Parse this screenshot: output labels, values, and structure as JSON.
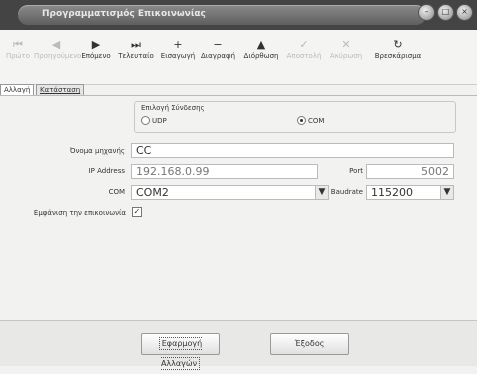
{
  "window": {
    "title": "Προγραμματισμός Επικοινωνίας",
    "buttons": [
      "–",
      "□",
      "×"
    ]
  },
  "toolbar": [
    {
      "label": "Πρώτο",
      "icon": "first-icon",
      "glyph": "⏮",
      "enabled": false
    },
    {
      "label": "Προηγούμενο",
      "icon": "previous-icon",
      "glyph": "◀",
      "enabled": false
    },
    {
      "label": "Επόμενο",
      "icon": "next-icon",
      "glyph": "▶",
      "enabled": true
    },
    {
      "label": "Τελευταίο",
      "icon": "last-icon",
      "glyph": "⏭",
      "enabled": true
    },
    {
      "label": "Εισαγωγή",
      "icon": "insert-icon",
      "glyph": "+",
      "enabled": true
    },
    {
      "label": "Διαγραφή",
      "icon": "delete-icon",
      "glyph": "−",
      "enabled": true
    },
    {
      "label": "Διόρθωση",
      "icon": "edit-icon",
      "glyph": "▲",
      "enabled": true
    },
    {
      "label": "Αποστολή",
      "icon": "send-icon",
      "glyph": "✓",
      "enabled": false
    },
    {
      "label": "Ακύρωση",
      "icon": "cancel-icon",
      "glyph": "✕",
      "enabled": false
    },
    {
      "label": "Βρεσκάρισμα",
      "icon": "refresh-icon",
      "glyph": "↻",
      "enabled": true
    }
  ],
  "tabs": [
    {
      "label": "Αλλαγή",
      "active": true
    },
    {
      "label": "Κατάσταση",
      "active": false
    }
  ],
  "connection": {
    "group_label": "Επιλογή Σύνδεσης",
    "options": [
      {
        "label": "UDP",
        "selected": false
      },
      {
        "label": "COM",
        "selected": true
      }
    ]
  },
  "form": {
    "name_label": "Όνομα μηχανής",
    "name_value": "CC",
    "ip_label": "IP Address",
    "ip_value": "192.168.0.99",
    "port_label": "Port",
    "port_value": "5002",
    "com_label": "COM",
    "com_value": "COM2",
    "baud_label": "Baudrate",
    "baud_value": "115200",
    "show_comm_label": "Εμφάνιση την επικοινωνία",
    "show_comm_checked": "✓"
  },
  "footer": {
    "apply_label": "Εφαρμογή Αλλαγών",
    "exit_label": "Έξοδος"
  }
}
